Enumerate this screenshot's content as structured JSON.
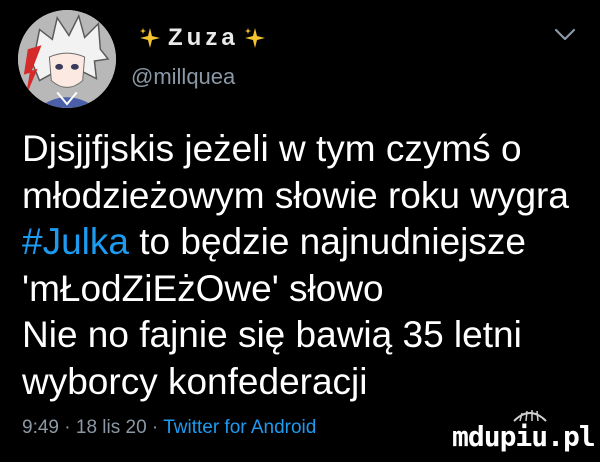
{
  "author": {
    "display_name": "Zuza",
    "handle": "@millquea",
    "avatar_icon": "anime-avatar-icon"
  },
  "menu": {
    "icon": "chevron-down-icon"
  },
  "tweet": {
    "line1": "Djsjjfjskis jeżeli w tym czymś o",
    "line2": "młodzieżowym słowie roku wygra",
    "line3_hashtag": "#Julka",
    "line3_rest": " to będzie najnudniejsze",
    "line4": "'mŁodZiEżOwe' słowo",
    "line5": "Nie no fajnie się bawią 35 letni",
    "line6": "wyborcy konfederacji"
  },
  "meta": {
    "time": "9:49",
    "separator1": " · ",
    "date": "18 lis 20",
    "separator2": " · ",
    "source": "Twitter for Android"
  },
  "watermark": {
    "text": "mdupiu.pl"
  },
  "colors": {
    "background": "#000000",
    "text": "#ffffff",
    "secondary": "#8b98a5",
    "accent": "#1d9bf0",
    "sparkle": "#f4c430"
  }
}
